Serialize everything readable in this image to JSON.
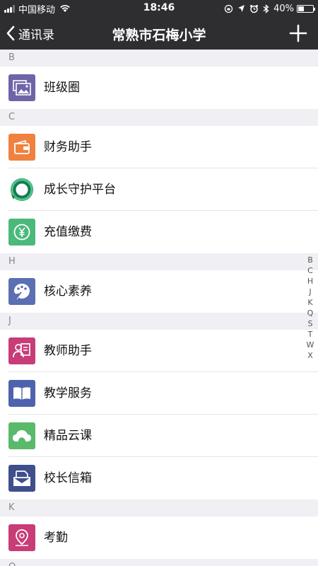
{
  "status_bar": {
    "carrier": "中国移动",
    "time": "18:46",
    "battery": "40%"
  },
  "nav": {
    "back_label": "通讯录",
    "title": "常熟市石梅小学"
  },
  "sections": [
    {
      "letter": "B",
      "items": [
        {
          "label": "班级圈",
          "icon": "class-circle-icon",
          "color": "#6e64a8"
        }
      ]
    },
    {
      "letter": "C",
      "items": [
        {
          "label": "财务助手",
          "icon": "wallet-icon",
          "color": "#f0813f"
        },
        {
          "label": "成长守护平台",
          "icon": "growth-guard-icon",
          "color": "#ffffff"
        },
        {
          "label": "充值缴费",
          "icon": "yuan-icon",
          "color": "#4ab97b"
        }
      ]
    },
    {
      "letter": "H",
      "items": [
        {
          "label": "核心素养",
          "icon": "palette-icon",
          "color": "#5b6fb2"
        }
      ]
    },
    {
      "letter": "J",
      "items": [
        {
          "label": "教师助手",
          "icon": "teacher-icon",
          "color": "#c83c77"
        },
        {
          "label": "教学服务",
          "icon": "book-icon",
          "color": "#4f62ad"
        },
        {
          "label": "精品云课",
          "icon": "cloud-icon",
          "color": "#5ab96a"
        },
        {
          "label": "校长信箱",
          "icon": "mailbox-icon",
          "color": "#3f4f8c"
        }
      ]
    },
    {
      "letter": "K",
      "items": [
        {
          "label": "考勤",
          "icon": "location-pin-icon",
          "color": "#c83c77"
        }
      ]
    },
    {
      "letter": "Q",
      "items": []
    }
  ],
  "index_letters": [
    "B",
    "C",
    "H",
    "J",
    "K",
    "Q",
    "S",
    "T",
    "W",
    "X"
  ]
}
